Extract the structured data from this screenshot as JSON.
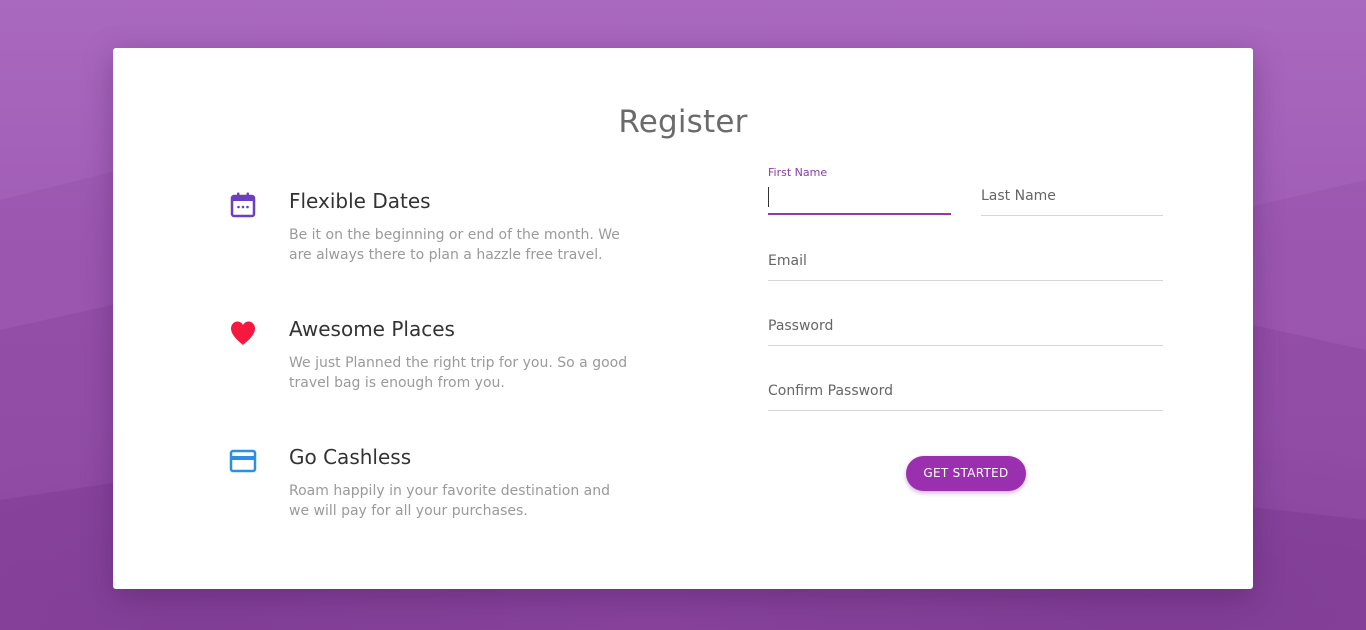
{
  "register": {
    "title": "Register",
    "features": [
      {
        "icon": "calendar-icon",
        "title": "Flexible Dates",
        "description": "Be it on the beginning or end of the month. We are always there to plan a hazzle free travel."
      },
      {
        "icon": "heart-icon",
        "title": "Awesome Places",
        "description": "We just Planned the right trip for you. So a good travel bag is enough from you."
      },
      {
        "icon": "credit-card-icon",
        "title": "Go Cashless",
        "description": "Roam happily in your favorite destination and we will pay for all your purchases."
      }
    ],
    "form": {
      "first_name_label": "First Name",
      "first_name_value": "",
      "last_name_label": "Last Name",
      "email_label": "Email",
      "password_label": "Password",
      "confirm_password_label": "Confirm Password",
      "submit_label": "GET STARTED"
    }
  },
  "colors": {
    "accent": "#9a2fb0",
    "background": "#a25cb8",
    "calendar_icon": "#6a3fc0",
    "heart_icon": "#f5193f",
    "card_icon": "#2b8fe8"
  }
}
